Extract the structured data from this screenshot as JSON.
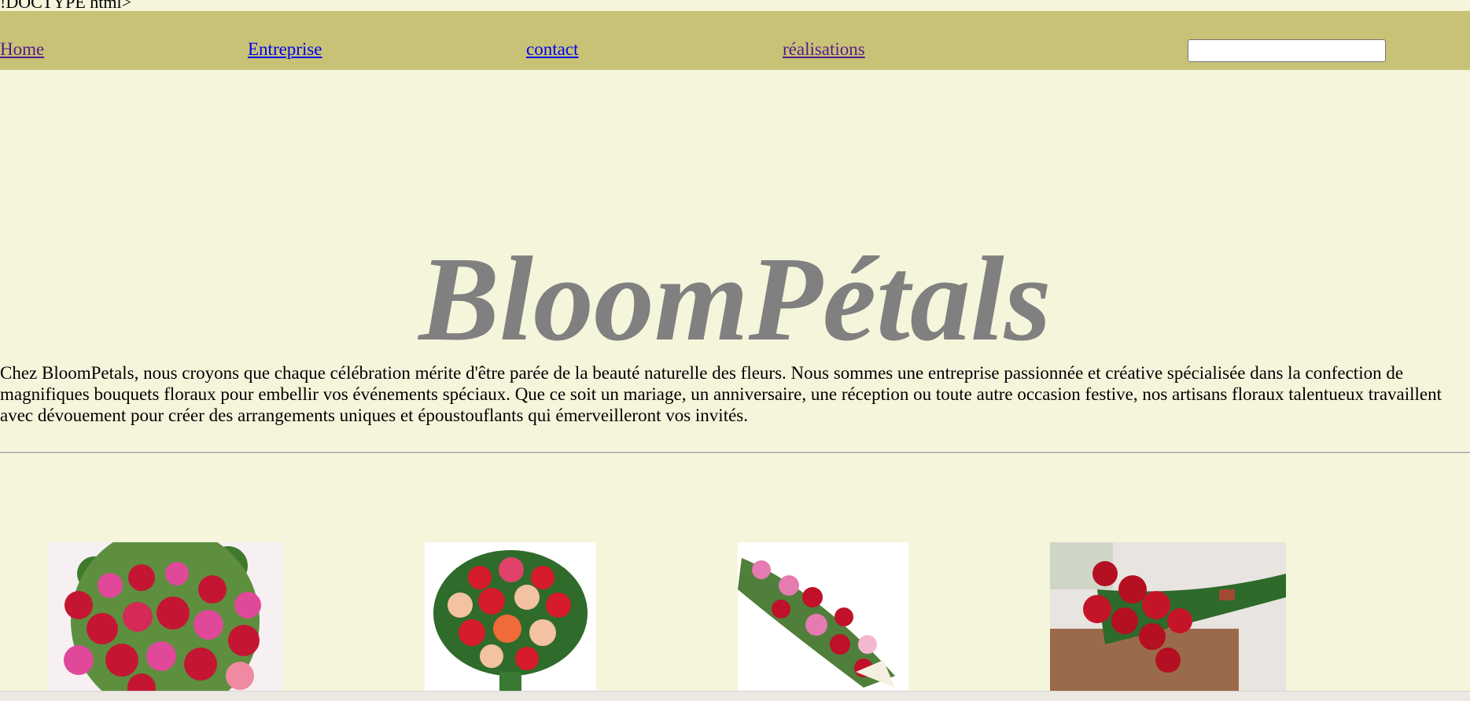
{
  "doctype_text": "!DOCTYPE html>",
  "nav": {
    "items": [
      {
        "label": "Home"
      },
      {
        "label": "Entreprise"
      },
      {
        "label": "contact"
      },
      {
        "label": "réalisations"
      }
    ],
    "search_value": ""
  },
  "hero": {
    "title": "BloomPétals"
  },
  "intro": {
    "text": "Chez BloomPetals, nous croyons que chaque célébration mérite d'être parée de la beauté naturelle des fleurs. Nous sommes une entreprise passionnée et créative spécialisée dans la confection de magnifiques bouquets floraux pour embellir vos événements spéciaux. Que ce soit un mariage, un anniversaire, une réception ou toute autre occasion festive, nos artisans floraux talentueux travaillent avec dévouement pour créer des arrangements uniques et époustouflants qui émerveilleront vos invités."
  },
  "gallery": {
    "images": [
      {
        "name": "bouquet-pink-red-roses-image",
        "colors": [
          "#f6f0f2",
          "#c41633",
          "#e0499a",
          "#3f7a2c"
        ]
      },
      {
        "name": "bouquet-mixed-roses-image",
        "colors": [
          "#ffffff",
          "#d61b2b",
          "#f3c2a0",
          "#2f6b2a"
        ]
      },
      {
        "name": "bouquet-lilies-image",
        "colors": [
          "#ffffff",
          "#c0102a",
          "#e57bb0",
          "#4f7f3a"
        ]
      },
      {
        "name": "bouquet-red-roses-on-table-image",
        "colors": [
          "#e8e4e0",
          "#b50f22",
          "#9a6b4a",
          "#2e6a2a"
        ]
      }
    ]
  }
}
